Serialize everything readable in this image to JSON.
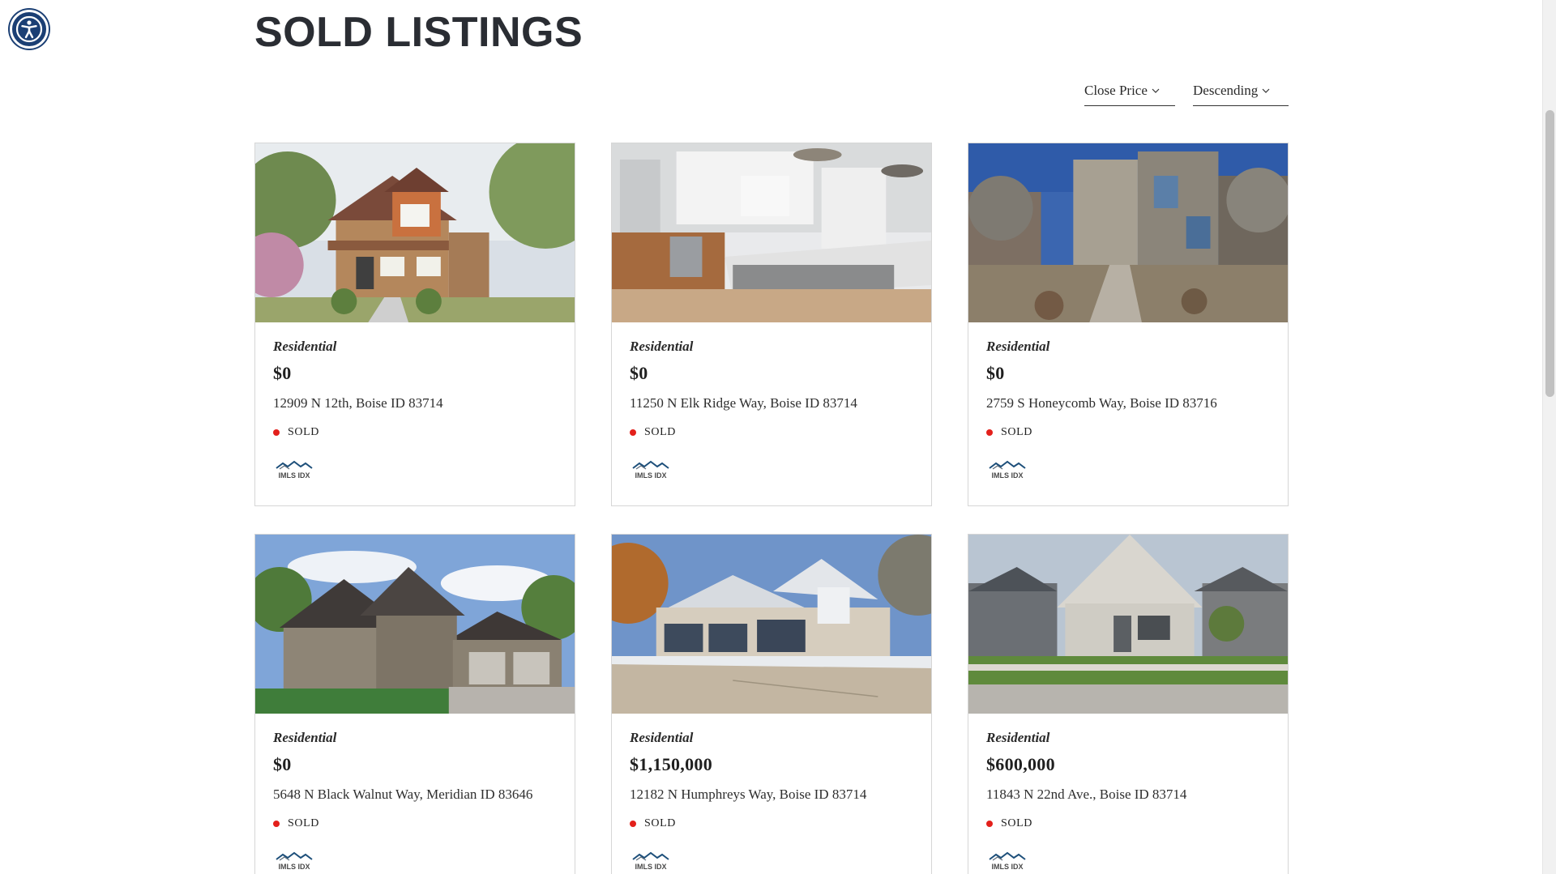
{
  "page": {
    "title": "SOLD LISTINGS",
    "accessibility_icon": "accessibility-icon"
  },
  "sort": {
    "field": {
      "label": "Close Price",
      "icon": "chevron-down-icon"
    },
    "order": {
      "label": "Descending",
      "icon": "chevron-down-icon"
    }
  },
  "listings": [
    {
      "type": "Residential",
      "price": "$0",
      "address": "12909 N 12th, Boise ID 83714",
      "status": "SOLD",
      "logo_text": "IMLS IDX"
    },
    {
      "type": "Residential",
      "price": "$0",
      "address": "11250 N Elk Ridge Way, Boise ID 83714",
      "status": "SOLD",
      "logo_text": "IMLS IDX"
    },
    {
      "type": "Residential",
      "price": "$0",
      "address": "2759 S Honeycomb Way, Boise ID 83716",
      "status": "SOLD",
      "logo_text": "IMLS IDX"
    },
    {
      "type": "Residential",
      "price": "$0",
      "address": "5648 N Black Walnut Way, Meridian ID 83646",
      "status": "SOLD",
      "logo_text": "IMLS IDX"
    },
    {
      "type": "Residential",
      "price": "$1,150,000",
      "address": "12182 N Humphreys Way, Boise ID 83714",
      "status": "SOLD",
      "logo_text": "IMLS IDX"
    },
    {
      "type": "Residential",
      "price": "$600,000",
      "address": "11843 N 22nd Ave., Boise ID 83714",
      "status": "SOLD",
      "logo_text": "IMLS IDX"
    }
  ],
  "colors": {
    "status_dot": "#e3201b",
    "accessibility_bg": "#1b3f74",
    "logo_blue": "#1d4f7a"
  }
}
